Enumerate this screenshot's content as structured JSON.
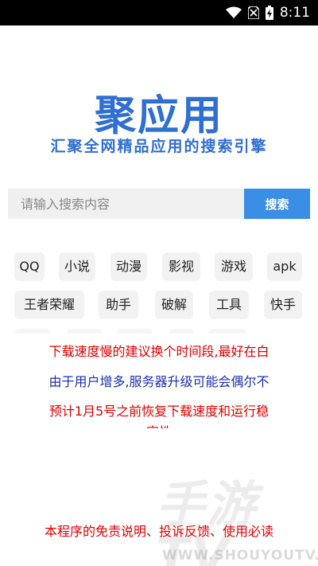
{
  "status_bar": {
    "time": "8:11"
  },
  "logo": {
    "title": "聚应用",
    "subtitle": "汇聚全网精品应用的搜索引擎"
  },
  "search": {
    "placeholder": "请输入搜索内容",
    "button_label": "搜索"
  },
  "tags": {
    "row1": [
      "QQ",
      "小说",
      "动漫",
      "影视",
      "游戏",
      "apk"
    ],
    "row2": [
      "王者荣耀",
      "助手",
      "破解",
      "工具",
      "快手"
    ]
  },
  "notice": {
    "line1": "下载速度慢的建议换个时间段,最好在白",
    "line2": "由于用户增多,服务器升级可能会偶尔不",
    "line3": "预计1月5号之前恢复下载速度和运行稳",
    "line4": "定性"
  },
  "footer": {
    "link": "本程序的免责说明、投诉反馈、使用必读"
  },
  "watermark": {
    "big": "手游TV",
    "small": "WWW.SHOUYOUTV.COM"
  },
  "colors": {
    "brand": "#2f6fd1",
    "button": "#3a8ee6",
    "notice_red": "#e00000",
    "notice_blue": "#1a2fb0"
  }
}
